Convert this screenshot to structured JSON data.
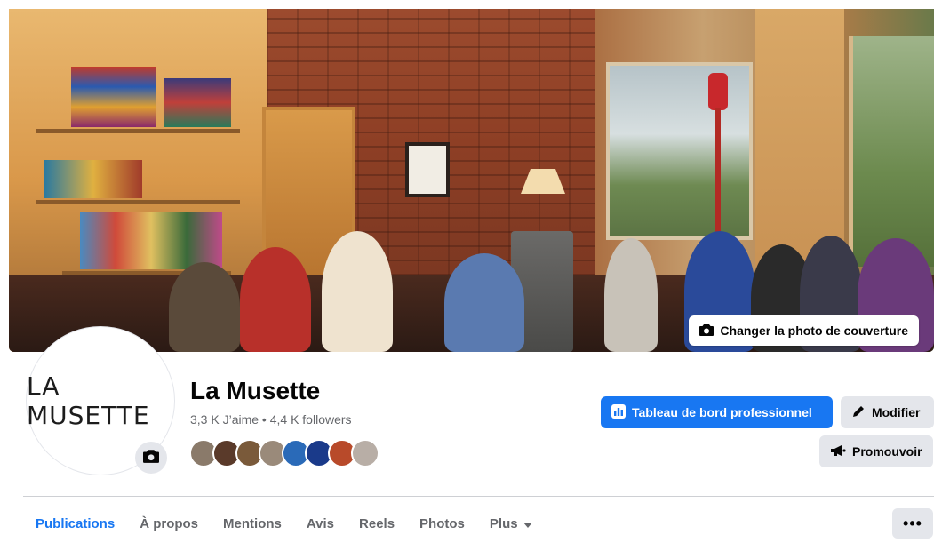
{
  "cover": {
    "change_button_label": "Changer la photo de couverture",
    "change_button_icon": "camera-icon"
  },
  "page": {
    "logo_text": "LA MUSETTE",
    "name": "La Musette",
    "stats": "3,3 K J’aime • 4,4 K followers",
    "avatar_camera_icon": "camera-icon",
    "friend_avatars": [
      {
        "color": "#8a7a6a"
      },
      {
        "color": "#5a3a2a"
      },
      {
        "color": "#7a5a3a"
      },
      {
        "color": "#9a8a7a"
      },
      {
        "color": "#2a6ab8"
      },
      {
        "color": "#1a3a8a"
      },
      {
        "color": "#b84a2a"
      },
      {
        "color": "#b8aea6"
      }
    ]
  },
  "actions": {
    "dashboard_label": "Tableau de bord professionnel",
    "dashboard_icon": "bar-chart-icon",
    "edit_label": "Modifier",
    "edit_icon": "pencil-icon",
    "promote_label": "Promouvoir",
    "promote_icon": "megaphone-icon"
  },
  "tabs": {
    "items": [
      {
        "label": "Publications",
        "active": true
      },
      {
        "label": "À propos",
        "active": false
      },
      {
        "label": "Mentions",
        "active": false
      },
      {
        "label": "Avis",
        "active": false
      },
      {
        "label": "Reels",
        "active": false
      },
      {
        "label": "Photos",
        "active": false
      },
      {
        "label": "Plus",
        "active": false
      }
    ],
    "more_button": "•••"
  },
  "colors": {
    "accent": "#1877f2",
    "secondary_button": "#e4e6eb",
    "muted_text": "#65676b"
  }
}
